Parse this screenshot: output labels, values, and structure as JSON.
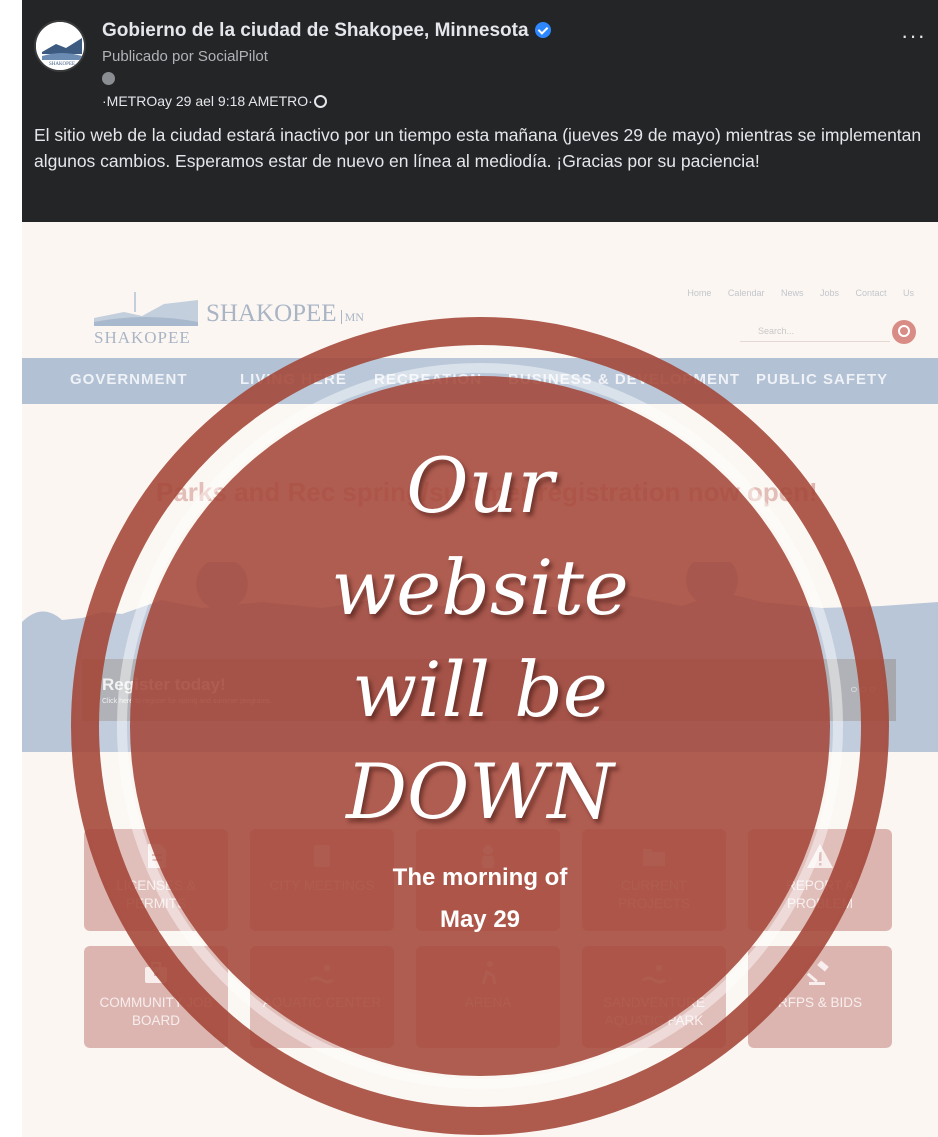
{
  "post": {
    "page_name": "Gobierno de la ciudad de Shakopee, Minnesota",
    "published_by": "Publicado por SocialPilot",
    "timestamp": "·METROay 29 ael 9:18 AMETRO·",
    "more_label": "···",
    "body_text": "El sitio web de la ciudad estará inactivo por un tiempo esta mañana (jueves 29 de mayo) mientras se implementan algunos cambios. Esperamos estar de nuevo en línea al mediodía. ¡Gracias por su paciencia!"
  },
  "website": {
    "logo_word": "SHAKOPEE",
    "logo_big": "SHAKOPEE",
    "logo_mn": "MN",
    "top_links": "Home Calendar News Jobs Contact Us",
    "search_placeholder": "Search...",
    "nav_items": [
      "GOVERNMENT",
      "LIVING HERE",
      "RECREATION",
      "BUSINESS & DEVELOPMENT",
      "PUBLIC SAFETY"
    ],
    "banner_text": "Parks and Rec spring/summer registration now open!",
    "register_title": "Register today!",
    "register_sub": "Click here to register for spring and summer programs.",
    "carousel_dots": "○○○",
    "tiles": [
      {
        "label": "LICENSES & PERMITS",
        "icon": "document-icon"
      },
      {
        "label": "CITY MEETINGS",
        "icon": "clipboard-icon"
      },
      {
        "label": "",
        "icon": "people-icon"
      },
      {
        "label": "CURRENT PROJECTS",
        "icon": "folder-icon"
      },
      {
        "label": "REPORT A PROBLEM",
        "icon": "warning-icon"
      },
      {
        "label": "COMMUNITY JOB BOARD",
        "icon": "briefcase-icon"
      },
      {
        "label": "AQUATIC CENTER",
        "icon": "swimmer-icon"
      },
      {
        "label": "ARENA",
        "icon": "skater-icon"
      },
      {
        "label": "SANDVENTURE AQUATIC PARK",
        "icon": "swimmer-icon"
      },
      {
        "label": "RFPS & BIDS",
        "icon": "gavel-icon"
      }
    ]
  },
  "overlay": {
    "line1": "Our",
    "line2": "website",
    "line3": "will be",
    "line4": "DOWN",
    "line5": "The morning of",
    "line6": "May 29"
  },
  "colors": {
    "facebook_dark": "#242526",
    "circle_red": "#a34436",
    "verified_blue": "#2d88ff"
  }
}
